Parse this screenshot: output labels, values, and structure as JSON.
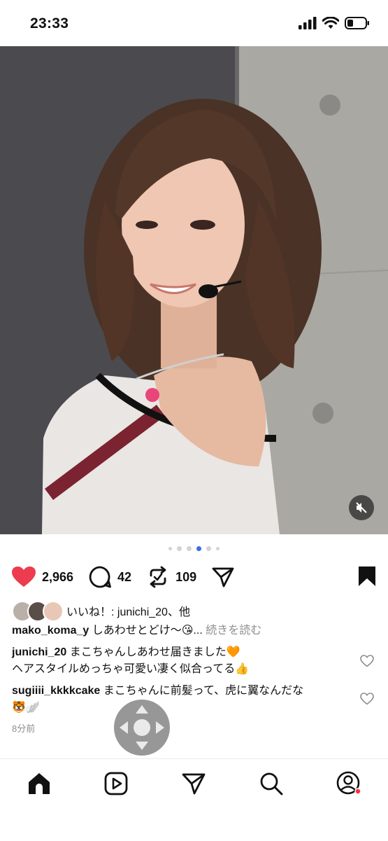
{
  "status_bar": {
    "time": "23:33"
  },
  "post": {
    "carousel": {
      "total": 6,
      "active_index": 3
    },
    "likes_count": "2,966",
    "comments_count": "42",
    "reposts_count": "109",
    "liked_by_label": "いいね！: junichi_20、他",
    "caption": {
      "username": "mako_koma_y",
      "text": "しあわせとどけ～😘...",
      "more_label": "続きを読む"
    },
    "comments": [
      {
        "username": "junichi_20",
        "text": "まこちゃんしあわせ届きました🧡\nヘアスタイルめっちゃ可愛い凄く似合ってる👍"
      },
      {
        "username": "sugiiii_kkkkcake",
        "text": "まこちゃんに前髪って、虎に翼なんだな\n🐯🪽"
      }
    ],
    "timestamp": "8分前"
  },
  "icons": {
    "like": "heart-filled-icon",
    "comment": "comment-bubble-icon",
    "repost": "repost-icon",
    "share": "send-icon",
    "save": "bookmark-filled-icon",
    "mute": "speaker-muted-icon"
  },
  "tab_bar": [
    "home-icon",
    "reels-icon",
    "send-icon",
    "search-icon",
    "profile-icon"
  ],
  "colors": {
    "like": "#ed3b4f",
    "carousel_active": "#3b6cf0",
    "notification": "#ff3040"
  }
}
